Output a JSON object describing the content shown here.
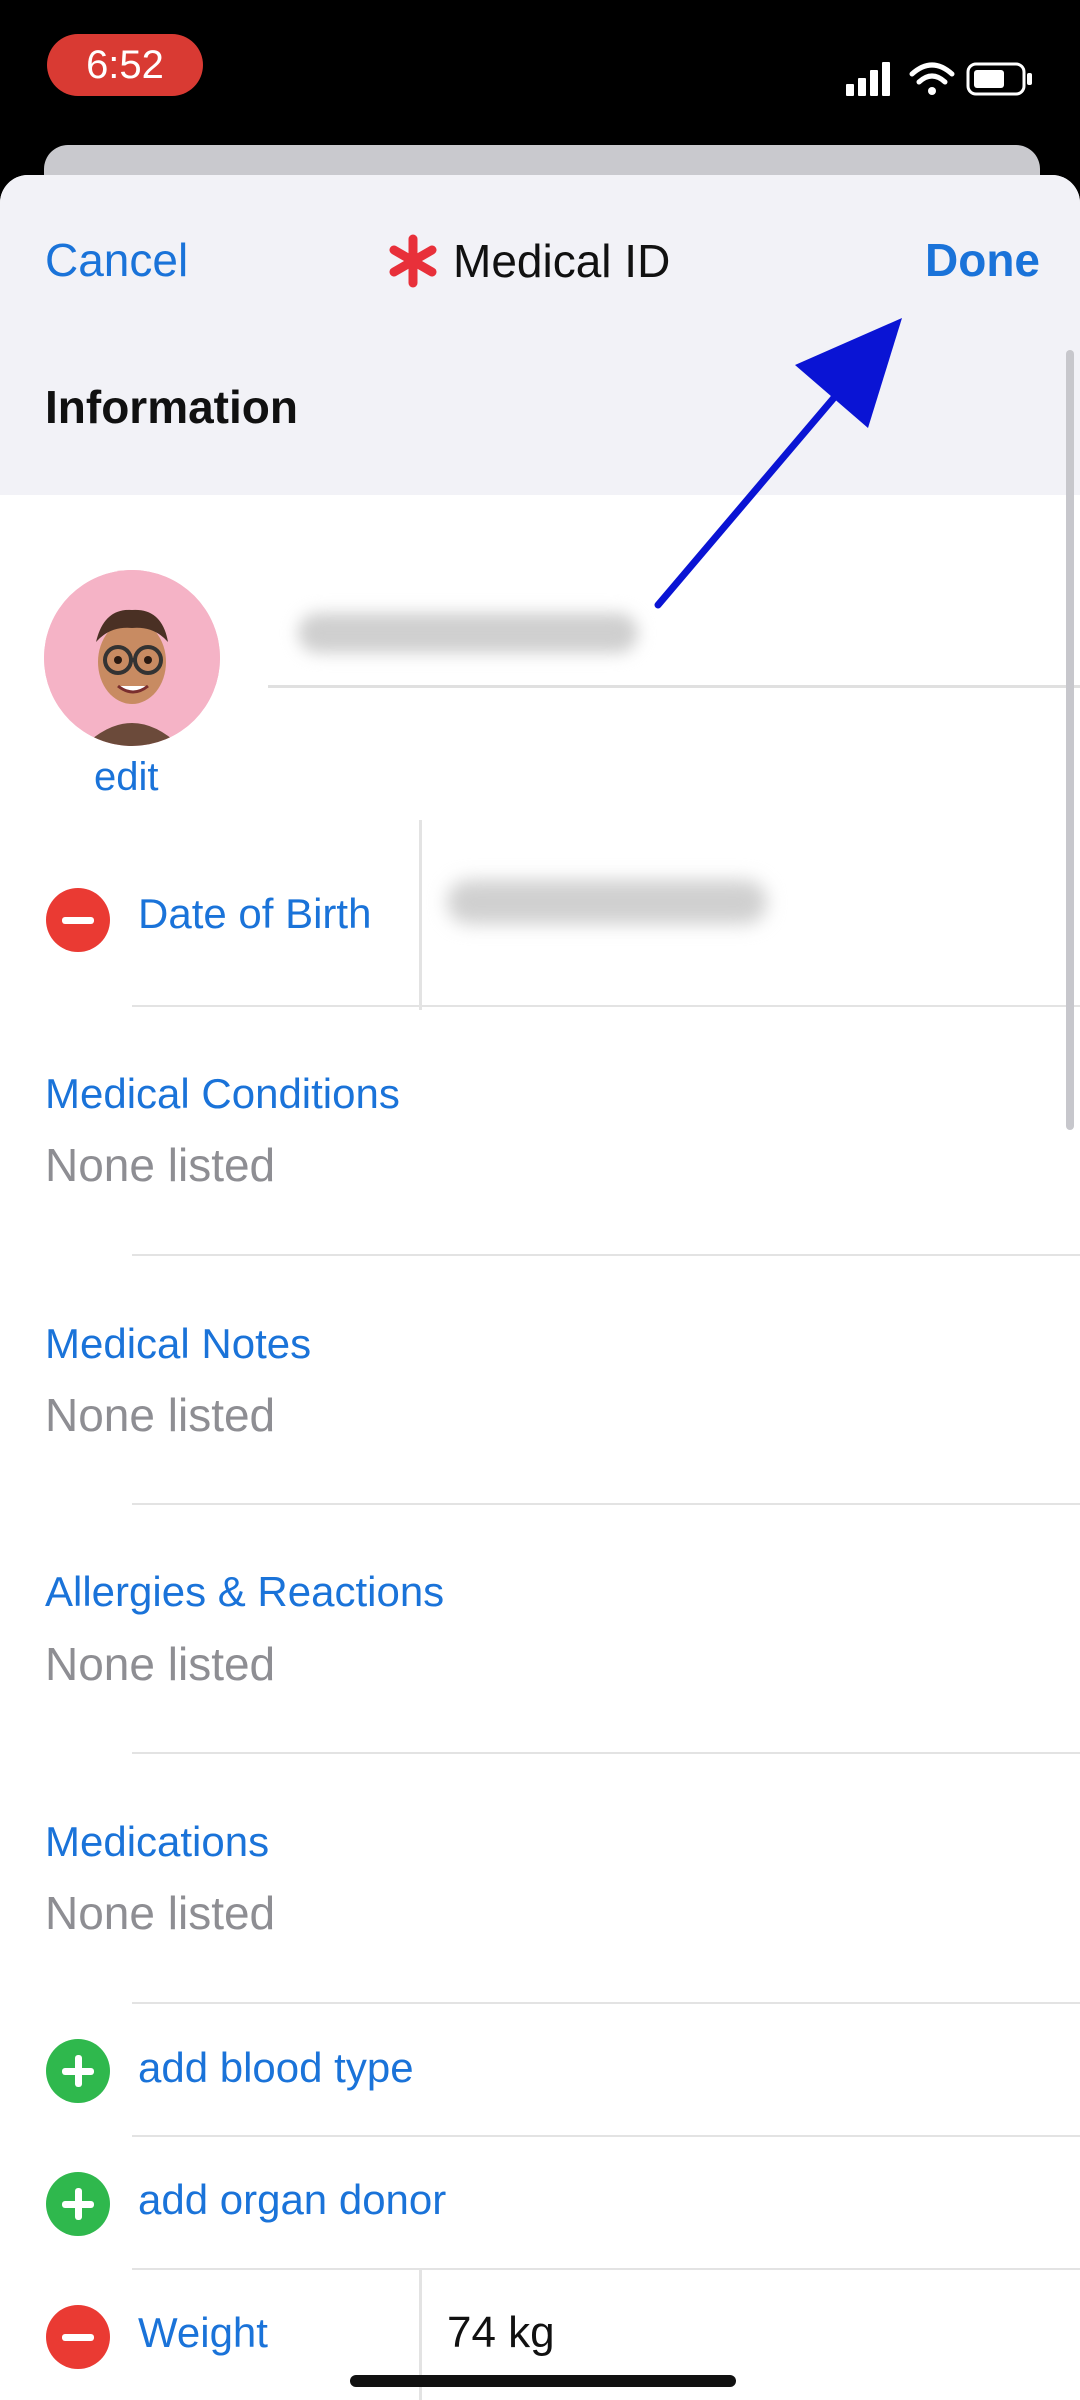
{
  "status_bar": {
    "time": "6:52",
    "icons": [
      "cellular-signal-icon",
      "wifi-icon",
      "battery-icon"
    ]
  },
  "nav": {
    "cancel_label": "Cancel",
    "title": "Medical ID",
    "done_label": "Done",
    "title_icon": "medical-asterisk-icon"
  },
  "section": {
    "title": "Information"
  },
  "profile": {
    "edit_label": "edit",
    "avatar_icon": "memoji-avatar"
  },
  "dob": {
    "label": "Date of Birth"
  },
  "fields": [
    {
      "title": "Medical Conditions",
      "value": "None listed"
    },
    {
      "title": "Medical Notes",
      "value": "None listed"
    },
    {
      "title": "Allergies & Reactions",
      "value": "None listed"
    },
    {
      "title": "Medications",
      "value": "None listed"
    }
  ],
  "add_rows": [
    {
      "label": "add blood type"
    },
    {
      "label": "add organ donor"
    }
  ],
  "weight": {
    "label": "Weight",
    "value": "74 kg"
  },
  "colors": {
    "accent": "#1a73d9",
    "destructive": "#ea3a33",
    "add": "#2fb84d",
    "asterisk": "#e8303a",
    "annotation_arrow": "#0a14d4"
  }
}
